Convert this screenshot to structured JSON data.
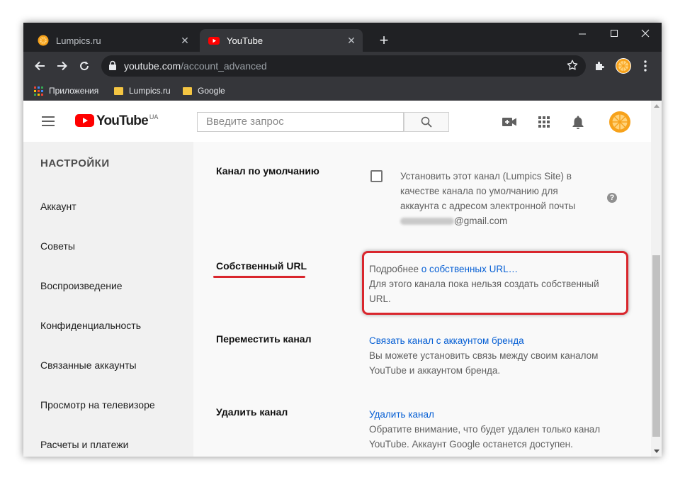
{
  "browser": {
    "tabs": [
      {
        "title": "Lumpics.ru",
        "active": false
      },
      {
        "title": "YouTube",
        "active": true
      }
    ],
    "address": {
      "host": "youtube.com",
      "path": "/account_advanced"
    },
    "bookmarks": [
      {
        "label": "Приложения",
        "icon": "apps-grid-icon"
      },
      {
        "label": "Lumpics.ru",
        "icon": "folder-icon"
      },
      {
        "label": "Google",
        "icon": "folder-icon"
      }
    ]
  },
  "youtube": {
    "logo_text": "YouTube",
    "region": "UA",
    "search_placeholder": "Введите запрос"
  },
  "sidebar": {
    "heading": "НАСТРОЙКИ",
    "items": [
      "Аккаунт",
      "Советы",
      "Воспроизведение",
      "Конфиденциальность",
      "Связанные аккаунты",
      "Просмотр на телевизоре",
      "Расчеты и платежи"
    ]
  },
  "sections": {
    "default_channel": {
      "label": "Канал по умолчанию",
      "text_line1": "Установить этот канал (Lumpics Site) в",
      "text_line2": "качестве канала по умолчанию для",
      "text_line3": "аккаунта с адресом электронной почты",
      "email_suffix": "@gmail.com",
      "checked": false
    },
    "custom_url": {
      "label": "Собственный URL",
      "prefix": "Подробнее",
      "link": "о собственных URL…",
      "text_line1": "Для этого канала пока нельзя создать собственный",
      "text_line2": "URL."
    },
    "move_channel": {
      "label": "Переместить канал",
      "link": "Связать канал с аккаунтом бренда",
      "text_line1": "Вы можете установить связь между своим каналом",
      "text_line2": "YouTube и аккаунтом бренда."
    },
    "delete_channel": {
      "label": "Удалить канал",
      "link": "Удалить канал",
      "text_line1": "Обратите внимание, что будет удален только канал",
      "text_line2": "YouTube. Аккаунт Google останется доступен."
    }
  },
  "colors": {
    "accent_red": "#d9262d",
    "link_blue": "#065fd4",
    "youtube_red": "#ff0000"
  }
}
